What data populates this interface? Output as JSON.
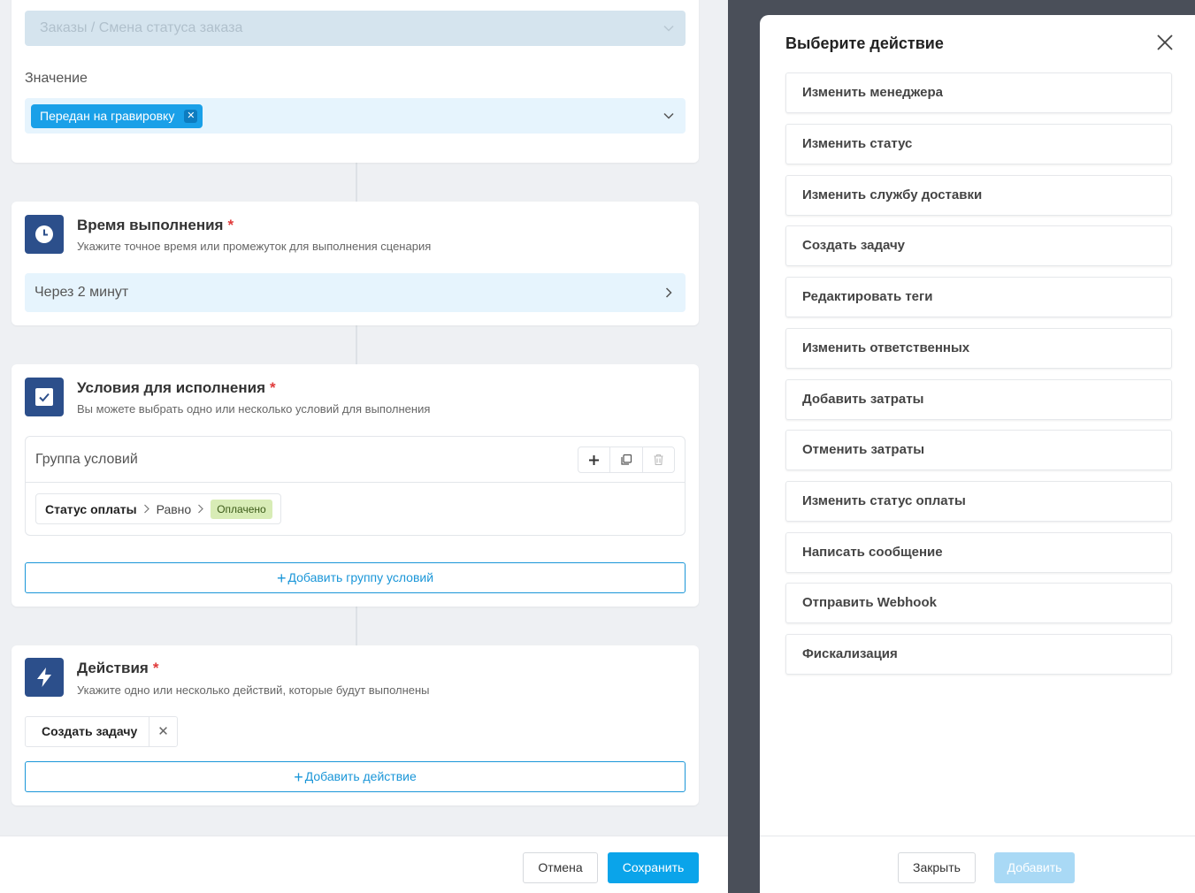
{
  "trigger": {
    "event_placeholder": "Заказы / Смена статуса заказа",
    "value_label": "Значение",
    "value_tag": "Передан на гравировку"
  },
  "time_section": {
    "title": "Время выполнения",
    "required_mark": "*",
    "subtitle": "Укажите точное время или промежуток для выполнения сценария",
    "value": "Через 2 минут"
  },
  "conditions_section": {
    "title": "Условия для исполнения",
    "required_mark": "*",
    "subtitle": "Вы можете выбрать одно или несколько условий для выполнения",
    "group_title": "Группа условий",
    "condition": {
      "field": "Статус оплаты",
      "operator": "Равно",
      "value": "Оплачено"
    },
    "add_group_label": "Добавить группу условий"
  },
  "actions_section": {
    "title": "Действия",
    "required_mark": "*",
    "subtitle": "Укажите одно или несколько действий, которые будут выполнены",
    "selected_action": "Создать задачу",
    "add_action_label": "Добавить действие"
  },
  "footer": {
    "cancel_label": "Отмена",
    "save_label": "Сохранить"
  },
  "modal": {
    "title": "Выберите действие",
    "actions": [
      "Изменить менеджера",
      "Изменить статус",
      "Изменить службу доставки",
      "Создать задачу",
      "Редактировать теги",
      "Изменить ответственных",
      "Добавить затраты",
      "Отменить затраты",
      "Изменить статус оплаты",
      "Написать сообщение",
      "Отправить Webhook",
      "Фискализация"
    ],
    "close_label": "Закрыть",
    "add_label": "Добавить"
  },
  "colors": {
    "accent": "#0aa4ea",
    "section_icon_bg": "#2c4f8b",
    "tag_bg": "#1aa0e8",
    "condition_value_bg": "#d8ecb6",
    "required": "#e03a3a",
    "overlay": "#4a4f59"
  }
}
